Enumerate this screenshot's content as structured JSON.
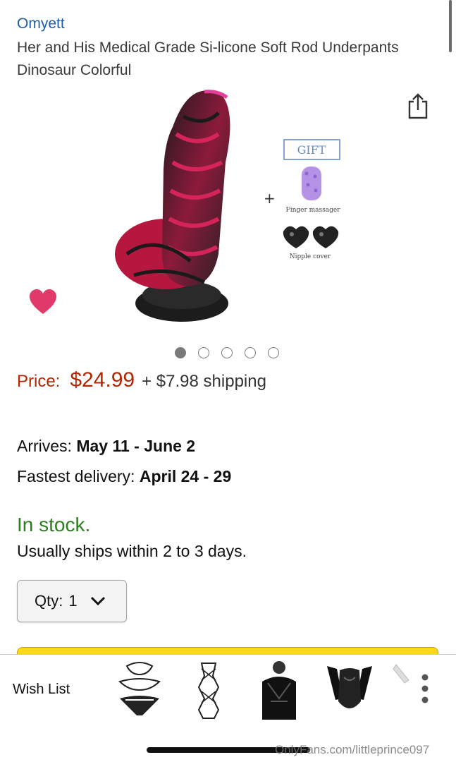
{
  "product": {
    "brand": "Omyett",
    "title": "Her and His Medical Grade Si-licone Soft Rod Underpants Dinosaur Colorful"
  },
  "gallery": {
    "gift_label": "GIFT",
    "plus_sign": "+",
    "finger_massager_caption": "Finger massager",
    "nipple_cover_caption": "Nipple cover",
    "image_count": 5,
    "active_index": 0
  },
  "pricing": {
    "label": "Price:",
    "value": "$24.99",
    "shipping": "+ $7.98 shipping"
  },
  "delivery": {
    "arrives_label": "Arrives:",
    "arrives_value": "May 11 - June 2",
    "fastest_label": "Fastest delivery:",
    "fastest_value": "April 24 - 29"
  },
  "stock": {
    "status": "In stock.",
    "ships": "Usually ships within 2 to 3 days."
  },
  "quantity": {
    "label": "Qty:",
    "value": "1"
  },
  "bottom_bar": {
    "wishlist_label": "Wish List"
  },
  "watermark": "OnlyFans.com/littleprince097",
  "colors": {
    "brand_link": "#1f5fa6",
    "price": "#b12704",
    "in_stock": "#2e7d1f",
    "add_to_cart": "#ffd814",
    "heart": "#e03a6a"
  },
  "icons": [
    "share-icon",
    "heart-icon",
    "chevron-down-icon",
    "more-vertical-icon"
  ]
}
